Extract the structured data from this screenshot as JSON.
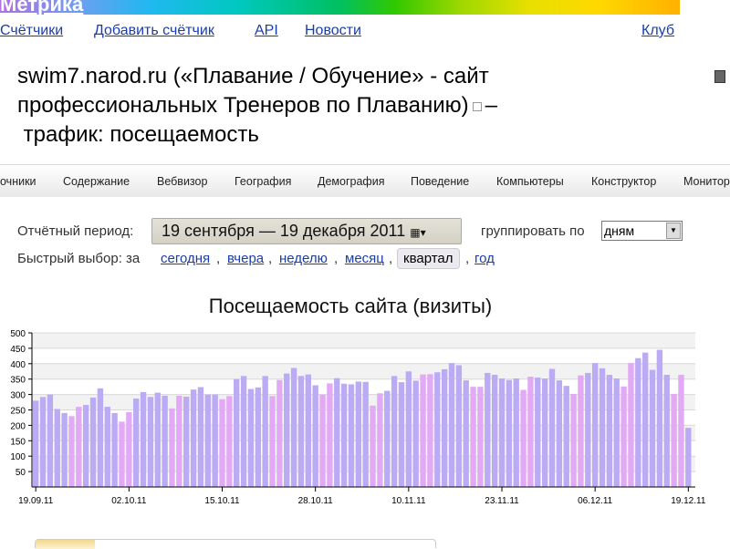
{
  "header": {
    "logo": "Метрика",
    "nav": [
      "Счётчики",
      "Добавить счётчик",
      "API",
      "Новости"
    ],
    "club": "Клуб"
  },
  "title": {
    "line1": "swim7.narod.ru («Плавание / Обучение» - сайт",
    "line2": "профессиональных Тренеров по Плаванию)",
    "dash": "–",
    "line3": "трафик: посещаемость"
  },
  "tabs": [
    "очники",
    "Содержание",
    "Вебвизор",
    "География",
    "Демография",
    "Поведение",
    "Компьютеры",
    "Конструктор",
    "Монитор"
  ],
  "period": {
    "label": "Отчётный период:",
    "value": "19 сентября — 19 декабря 2011",
    "group_label": "группировать по",
    "group_value": "дням"
  },
  "quick": {
    "label": "Быстрый выбор: за",
    "options": [
      "сегодня",
      "вчера",
      "неделю",
      "месяц",
      "квартал",
      "год"
    ],
    "active": "квартал"
  },
  "chart_data": {
    "type": "bar",
    "title": "Посещаемость сайта (визиты)",
    "ylim": [
      0,
      500
    ],
    "yticks": [
      50,
      100,
      150,
      200,
      250,
      300,
      350,
      400,
      450,
      500
    ],
    "xtick_labels": [
      "19.09.11",
      "02.10.11",
      "15.10.11",
      "28.10.11",
      "10.11.11",
      "23.11.11",
      "06.12.11",
      "19.12.11"
    ],
    "start_date": "19.09.11",
    "colors": {
      "weekday": "#bbaaf4",
      "weekend": "#e2aaf4"
    },
    "values": [
      280,
      292,
      300,
      253,
      240,
      230,
      260,
      266,
      290,
      320,
      260,
      240,
      212,
      243,
      287,
      308,
      292,
      306,
      296,
      255,
      296,
      293,
      316,
      324,
      300,
      300,
      285,
      295,
      350,
      360,
      318,
      323,
      360,
      295,
      347,
      368,
      386,
      360,
      365,
      330,
      300,
      336,
      353,
      335,
      333,
      342,
      341,
      264,
      304,
      312,
      360,
      340,
      375,
      345,
      365,
      366,
      372,
      382,
      402,
      395,
      346,
      325,
      325,
      370,
      364,
      352,
      347,
      352,
      315,
      358,
      355,
      352,
      383,
      346,
      328,
      302,
      362,
      370,
      402,
      385,
      364,
      352,
      326,
      402,
      418,
      436,
      380,
      445,
      364,
      302,
      364,
      192
    ]
  }
}
